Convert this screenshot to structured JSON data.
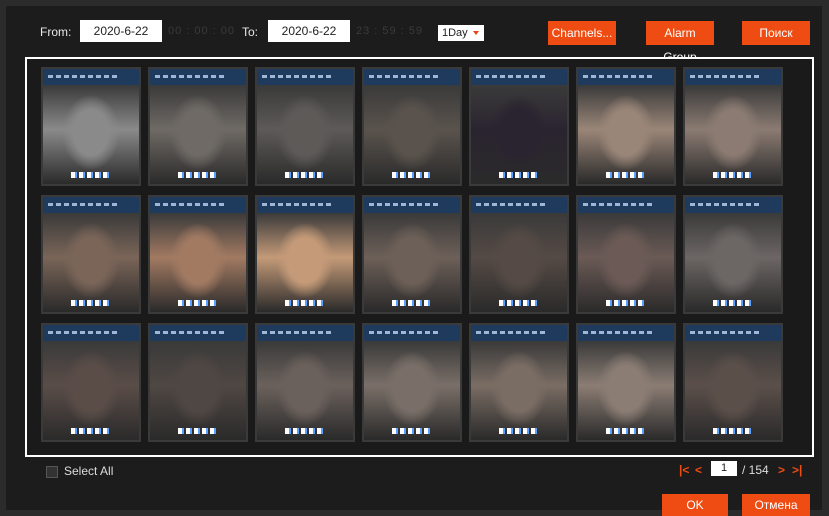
{
  "toolbar": {
    "from_label": "From:",
    "from_date": "2020-6-22",
    "from_time": "00 : 00 : 00",
    "to_label": "To:",
    "to_date": "2020-6-22",
    "to_time": "23 : 59 : 59",
    "period_value": "1Day",
    "channels_label": "Channels...",
    "alarm_group_label": "Alarm Group",
    "search_label": "Поиск"
  },
  "grid": {
    "rows": 3,
    "cols": 7,
    "face_tones": [
      [
        "#8a8a8a",
        "#6f6a65",
        "#5d5a58",
        "#5a534d",
        "#2a2430",
        "#9a8678",
        "#8b7b72"
      ],
      [
        "#7a6558",
        "#a27a62",
        "#c49a78",
        "#6d6058",
        "#554a45",
        "#6b5a55",
        "#6c6664"
      ],
      [
        "#5a4d48",
        "#4f4743",
        "#6b615c",
        "#7a6f68",
        "#7a6d64",
        "#8b7d74",
        "#5b4f4a"
      ]
    ]
  },
  "footer": {
    "select_all_label": "Select All",
    "page_current": "1",
    "page_total": "/ 154",
    "first_icon": "first-page-icon",
    "prev_icon": "prev-page-icon",
    "next_icon": "next-page-icon",
    "last_icon": "last-page-icon",
    "ok_label": "OK",
    "cancel_label": "Отмена"
  },
  "colors": {
    "accent": "#ee4c12",
    "header_blue": "#1e3a5c"
  }
}
